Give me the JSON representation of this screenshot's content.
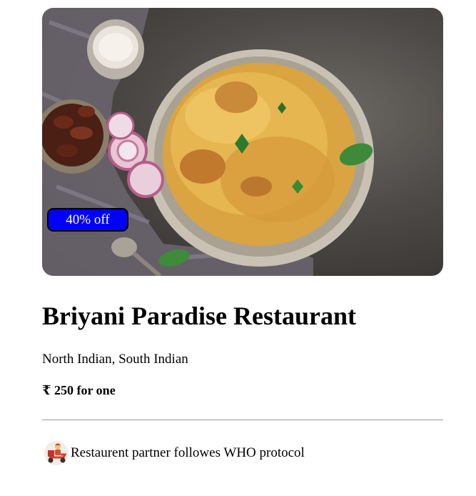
{
  "restaurant": {
    "image_icon": "biryani-photo",
    "offer": "40% off",
    "name": "Briyani Paradise Restaurant",
    "cuisines": "North Indian, South Indian",
    "price": "₹ 250 for one",
    "protocol_icon": "delivery-scooter-icon",
    "protocol_text": "Restaurent partner followes WHO protocol"
  },
  "colors": {
    "offer_badge_bg": "#0000ff",
    "divider": "#9a9a9a"
  }
}
